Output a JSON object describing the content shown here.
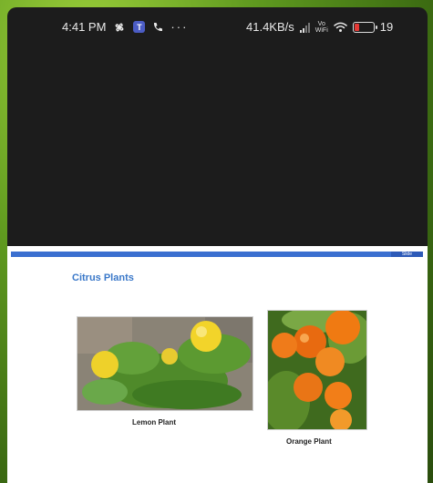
{
  "statusbar": {
    "time": "4:41 PM",
    "net_speed": "41.4KB/s",
    "battery_level": "19",
    "vowifi_top": "Vo",
    "vowifi_bottom": "WiFi",
    "teams_letter": "T",
    "more_label": "···",
    "icons": [
      "pinwheel-icon",
      "teams-icon",
      "phone-call-icon",
      "more-dots-icon",
      "signal-icon",
      "vowifi-icon",
      "wifi-icon",
      "battery-icon"
    ],
    "battery_color": "#e53935"
  },
  "slide": {
    "badge": "Slide",
    "title": "Citrus Plants",
    "accent": "#3b6fd0",
    "title_color": "#3a78c9",
    "items": [
      {
        "caption": "Lemon Plant"
      },
      {
        "caption": "Orange Plant"
      }
    ]
  }
}
